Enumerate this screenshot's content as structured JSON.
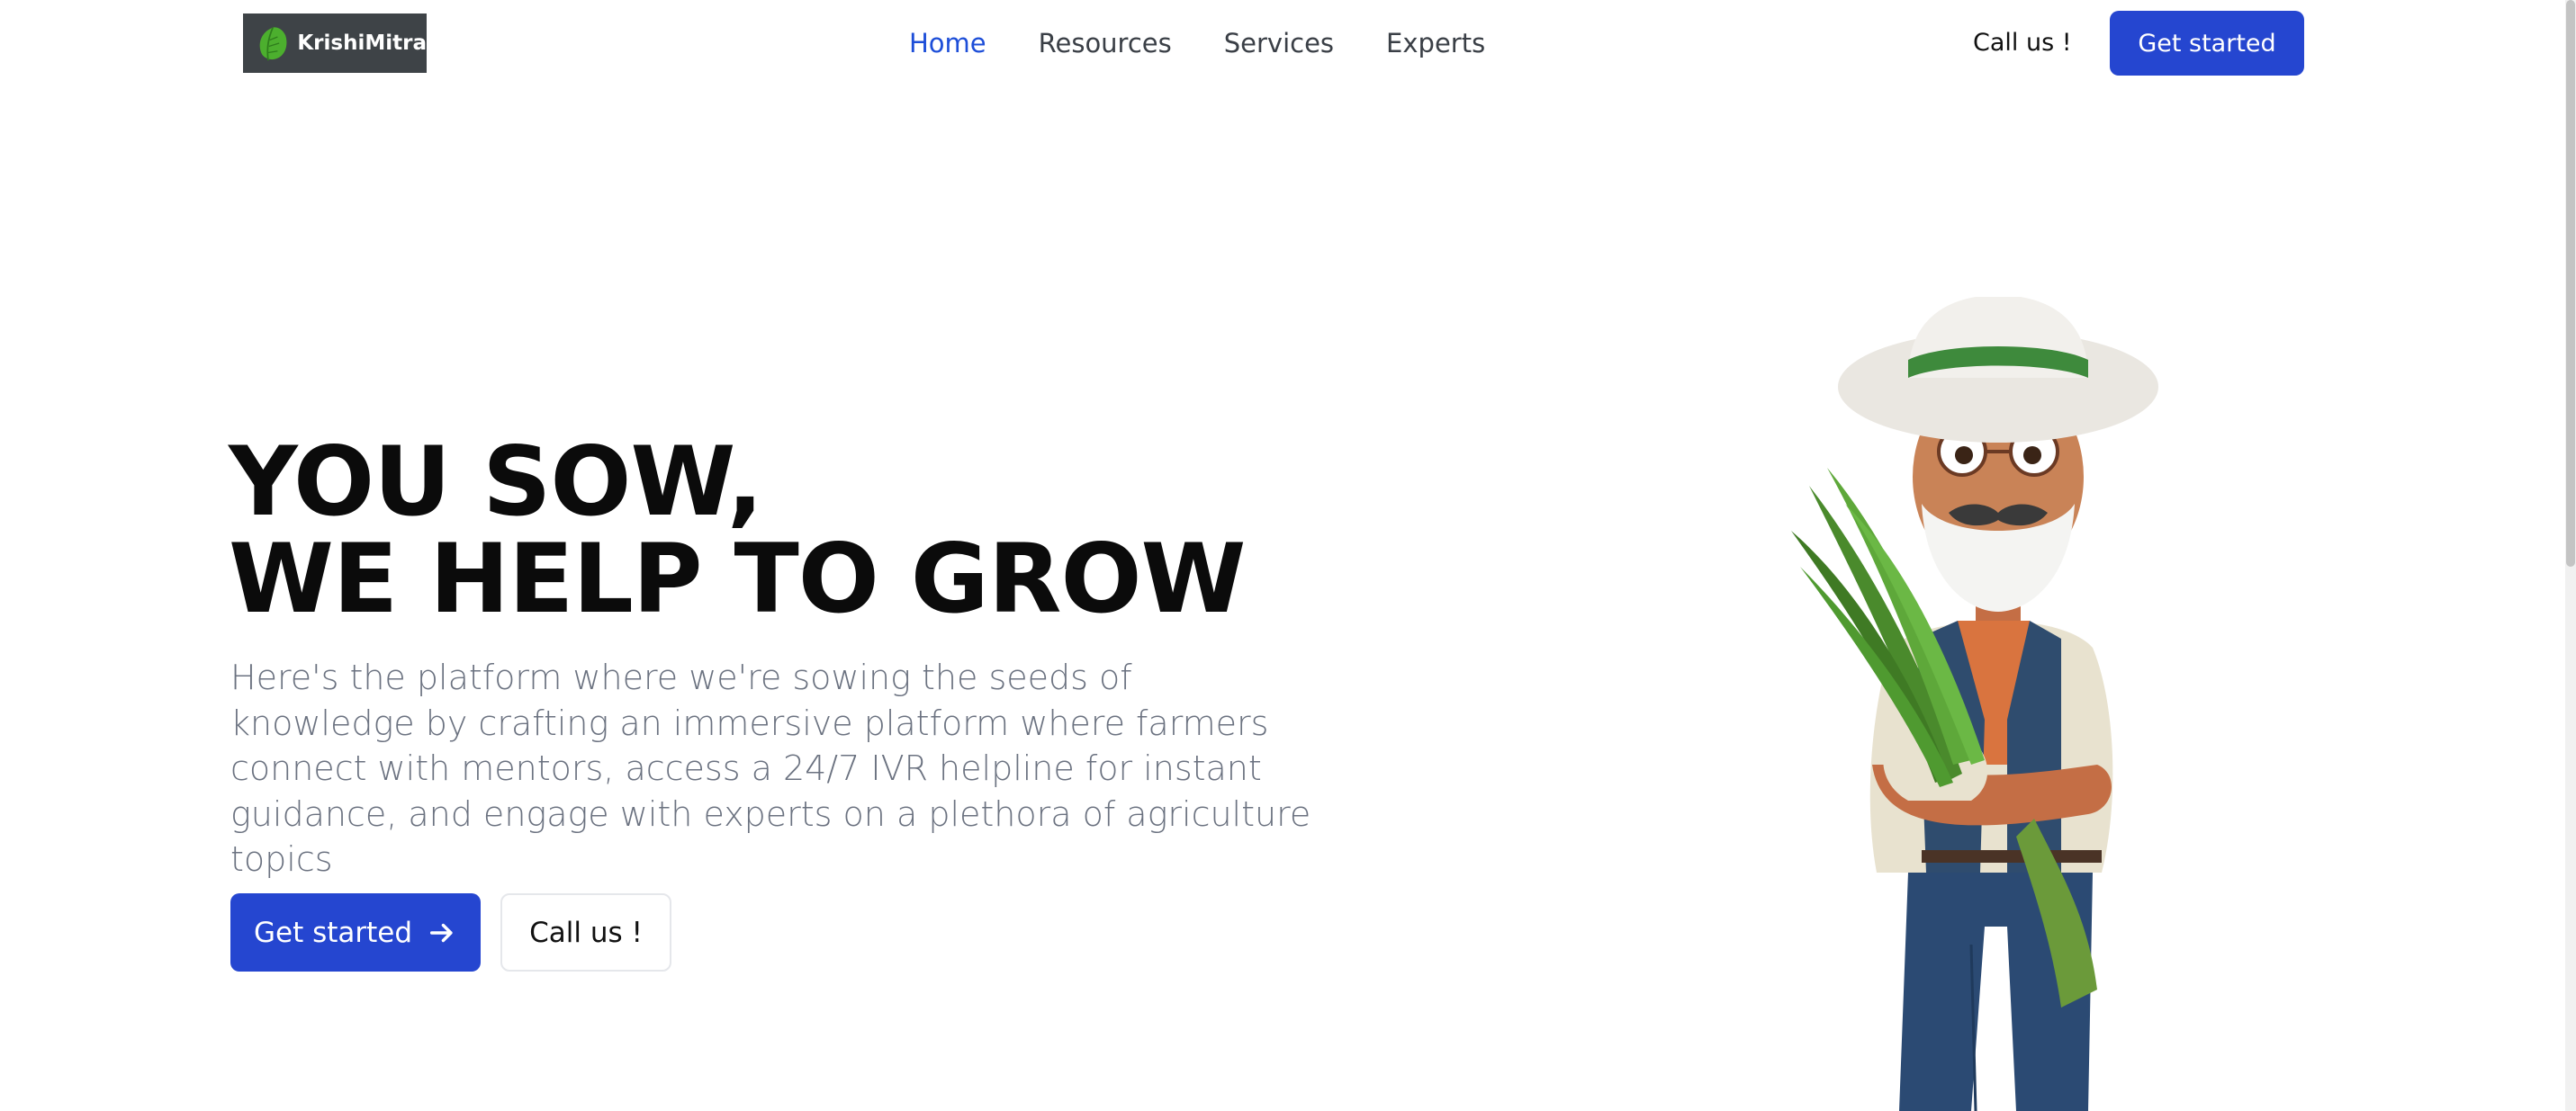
{
  "brand": {
    "name": "KrishiMitra",
    "logo_icon": "leaf-icon"
  },
  "nav": {
    "items": [
      {
        "label": "Home",
        "active": true
      },
      {
        "label": "Resources",
        "active": false
      },
      {
        "label": "Services",
        "active": false
      },
      {
        "label": "Experts",
        "active": false
      }
    ]
  },
  "header": {
    "call_label": "Call us !",
    "cta_label": "Get started"
  },
  "hero": {
    "title_line1": "YOU SOW,",
    "title_line2": "WE HELP TO GROW",
    "description": "Here's the platform where we're sowing the seeds of knowledge by crafting an immersive platform where farmers connect with mentors, access a 24/7 IVR helpline for instant guidance, and engage with experts on a plethora of agriculture topics",
    "primary_button": "Get started",
    "primary_button_icon": "arrow-right-icon",
    "secondary_button": "Call us !"
  },
  "colors": {
    "accent": "#2546d0",
    "nav_active": "#1d4ed8",
    "body_text": "#6b7280",
    "logo_bg": "#3e4347"
  }
}
